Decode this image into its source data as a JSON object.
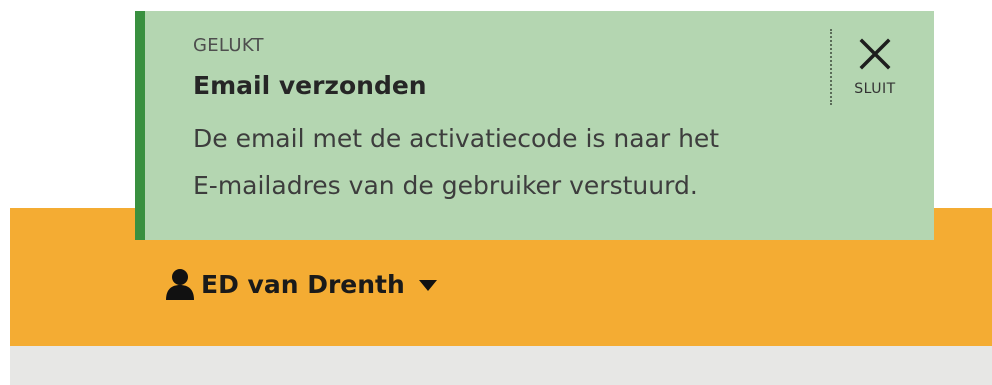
{
  "notification": {
    "kicker": "GELUKT",
    "title": "Email verzonden",
    "message_line1": "De email met de activatiecode is naar het",
    "message_line2": "E-mailadres van de gebruiker verstuurd.",
    "close_label": "SLUIT",
    "close_icon": "close-icon",
    "status": "success",
    "background_color": "#b4d6b1",
    "accent_color": "#39903f"
  },
  "header": {
    "background_color": "#f4ac33",
    "user_menu": {
      "name": "ED van Drenth",
      "icon": "user-icon",
      "dropdown_icon": "caret-down-icon"
    }
  },
  "subheader": {
    "background_color": "#e7e7e5"
  }
}
